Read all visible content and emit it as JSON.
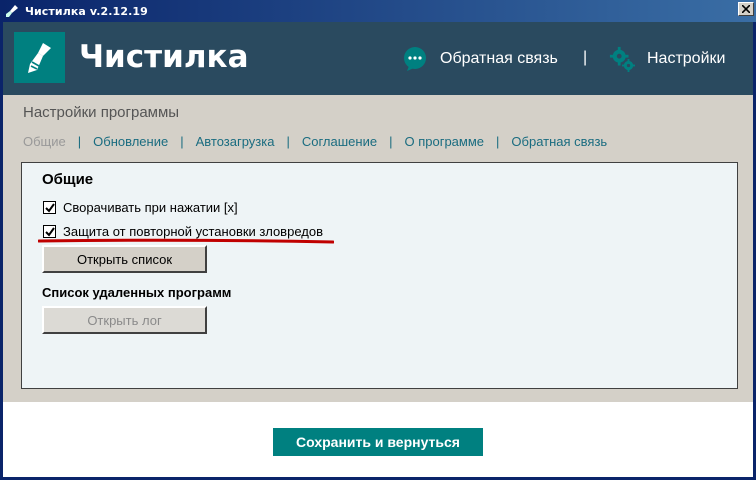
{
  "window": {
    "title": "Чистилка v.2.12.19"
  },
  "header": {
    "app_name": "Чистилка",
    "feedback_label": "Обратная связь",
    "separator": "|",
    "settings_label": "Настройки"
  },
  "page": {
    "section_title": "Настройки программы",
    "tabs": [
      {
        "label": "Общие",
        "active": true
      },
      {
        "label": "Обновление",
        "active": false
      },
      {
        "label": "Автозагрузка",
        "active": false
      },
      {
        "label": "Соглашение",
        "active": false
      },
      {
        "label": "О программе",
        "active": false
      },
      {
        "label": "Обратная связь",
        "active": false
      }
    ],
    "tab_separator": "|"
  },
  "panel": {
    "heading": "Общие",
    "options": [
      {
        "label": "Сворачивать при нажатии [x]",
        "checked": true
      },
      {
        "label": "Защита от повторной установки зловредов",
        "checked": true
      }
    ],
    "open_list_button": "Открыть список",
    "removed_programs_heading": "Список удаленных программ",
    "open_log_button": "Открыть лог"
  },
  "footer": {
    "save_button": "Сохранить и вернуться"
  },
  "colors": {
    "header_bg": "#2a4a5f",
    "accent": "#008080",
    "link": "#1a6c80",
    "highlight_underline": "#c00000"
  },
  "icons": [
    "broom-icon",
    "chat-bubble-icon",
    "gears-icon",
    "close-icon",
    "checkmark-icon"
  ]
}
